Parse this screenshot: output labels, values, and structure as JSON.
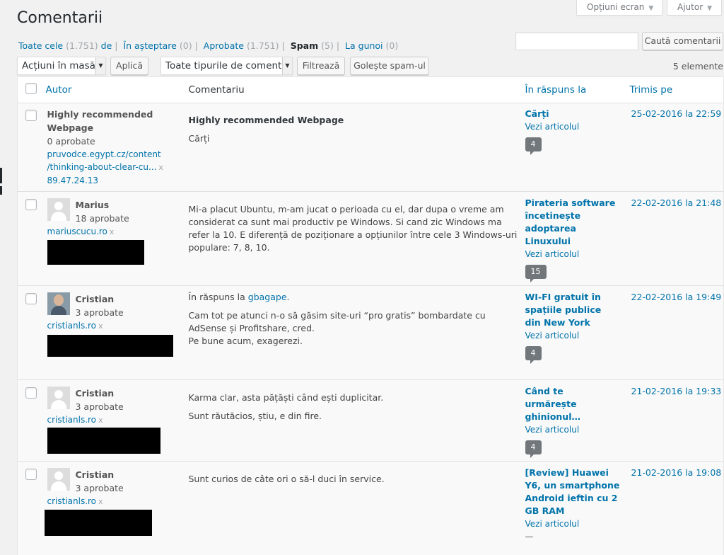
{
  "top_tabs": {
    "screen_options": "Opțiuni ecran",
    "help": "Ajutor"
  },
  "page_title": "Comentarii",
  "filters": {
    "all_label": "Toate cele",
    "all_count": "(1.751)",
    "all_suffix": "de",
    "pending_label": "În așteptare",
    "pending_count": "(0)",
    "approved_label": "Aprobate",
    "approved_count": "(1.751)",
    "spam_label": "Spam",
    "spam_count": "(5)",
    "trash_label": "La gunoi",
    "trash_count": "(0)"
  },
  "search": {
    "value": "",
    "button": "Caută comentarii"
  },
  "toolbar": {
    "bulk_actions": "Acțiuni în masă",
    "apply": "Aplică",
    "comment_types": "Toate tipurile de comenta",
    "filter": "Filtrează",
    "empty_spam": "Golește spam-ul",
    "items_count": "5 elemente"
  },
  "columns": {
    "author": "Autor",
    "comment": "Comentariu",
    "response": "În răspuns la",
    "submitted": "Trimis pe"
  },
  "rows": [
    {
      "author": "Highly recommended Webpage",
      "approved": "0 aprobate",
      "url": "pruvodce.egypt.cz/content/thinking-about-clear-cu...",
      "url_line1": "pruvodce.egypt.cz/content",
      "url_line2": "/thinking-about-clear-cu...",
      "ip": "89.47.24.13",
      "comment_title": "Highly recommended Webpage",
      "comment_body": "Cărți",
      "response_title": "Cărți",
      "view_post": "Vezi articolul",
      "comment_count": "4",
      "date": "25-02-2016 la 22:59"
    },
    {
      "author": "Marius",
      "approved": "18 aprobate",
      "url": "mariuscucu.ro",
      "comment_body": "Mi-a placut Ubuntu, m-am jucat o perioada cu el, dar dupa o vreme am considerat ca sunt mai productiv pe Windows. Si cand zic Windows ma refer la 10. E diferență de poziționare a opțiunilor între cele 3 Windows-uri populare: 7, 8, 10.",
      "response_title": "Pirateria software încetinește adoptarea Linuxului",
      "view_post": "Vezi articolul",
      "comment_count": "15",
      "date": "22-02-2016 la 21:48"
    },
    {
      "author": "Cristian",
      "approved": "3 aprobate",
      "url": "cristianls.ro",
      "reply_prefix": "În răspuns la",
      "reply_to": "gbagape",
      "comment_p1": "Cam tot pe atunci n-o să găsim site-uri “pro gratis” bombardate cu AdSense și Profitshare, cred.",
      "comment_p2": "Pe bune acum, exagerezi.",
      "response_title": "WI-FI gratuit în spațiile publice din New York",
      "view_post": "Vezi articolul",
      "comment_count": "4",
      "date": "22-02-2016 la 19:49"
    },
    {
      "author": "Cristian",
      "approved": "3 aprobate",
      "url": "cristianls.ro",
      "comment_p1": "Karma clar, asta pățăști când ești duplicitar.",
      "comment_p2": "Sunt răutăcios, știu, e din fire.",
      "response_title": "Când te urmărește ghinionul…",
      "view_post": "Vezi articolul",
      "comment_count": "4",
      "date": "21-02-2016 la 19:33"
    },
    {
      "author": "Cristian",
      "approved": "3 aprobate",
      "url": "cristianls.ro",
      "comment_body": "Sunt curios de câte ori o să-l duci în service.",
      "response_title": "[Review] Huawei Y6, un smartphone Android ieftin cu 2 GB RAM",
      "view_post": "Vezi articolul",
      "no_comments": "—",
      "date": "21-02-2016 la 19:08"
    }
  ]
}
